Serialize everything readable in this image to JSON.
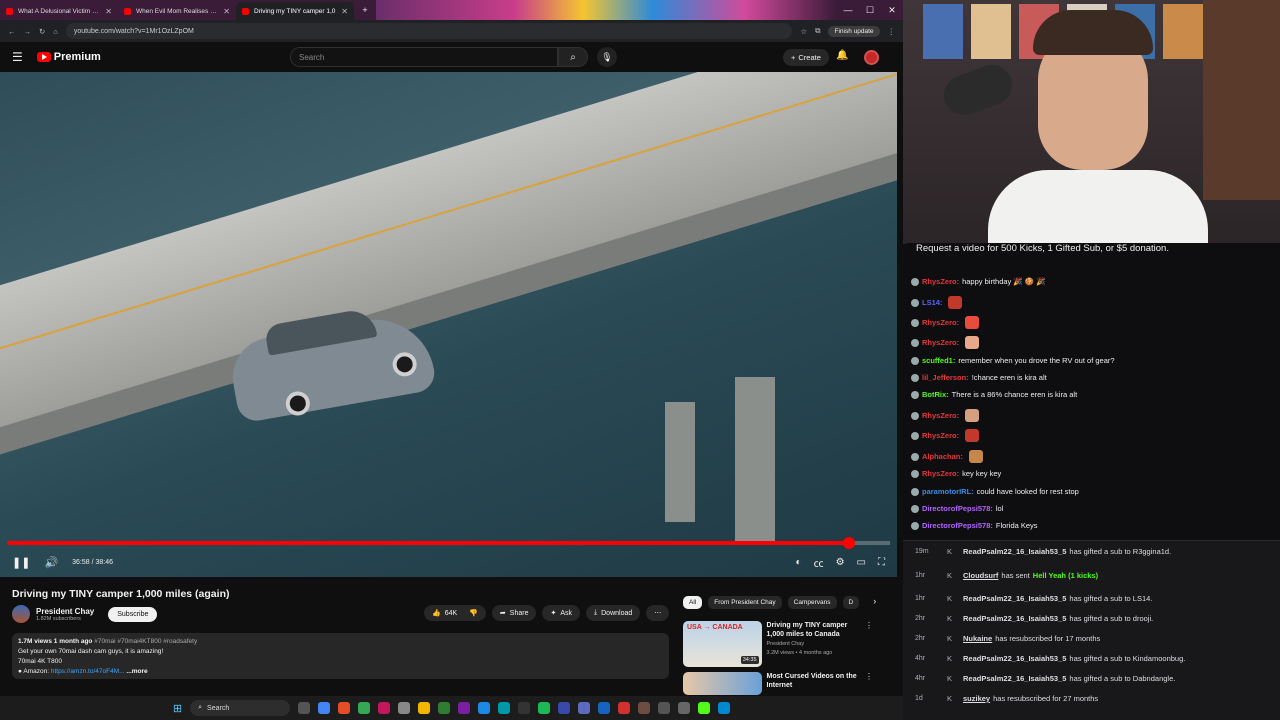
{
  "browser": {
    "tabs": [
      {
        "title": "What A Delusional Victim Com",
        "active": false
      },
      {
        "title": "When Evil Mom Realises She's",
        "active": false
      },
      {
        "title": "Driving my TINY camper 1,0",
        "active": true
      }
    ],
    "url": "youtube.com/watch?v=1Mr1OzLZpOM",
    "update_label": "Finish update"
  },
  "youtube": {
    "logo_text": "Premium",
    "search_placeholder": "Search",
    "create_label": "Create",
    "player": {
      "time": "36:58 / 38:46",
      "progress_fraction": 0.954
    },
    "video": {
      "title": "Driving my TINY camper 1,000 miles (again)",
      "channel": "President Chay",
      "subscribers": "1.82M subscribers",
      "subscribe_label": "Subscribe",
      "likes": "64K",
      "share_label": "Share",
      "ask_label": "Ask",
      "download_label": "Download",
      "description": {
        "meta": "1.7M views  1 month ago",
        "tags": "#70mai #70mai4KT800 #roadsafety",
        "line2": "Get your own 70mai dash cam guys, it is amazing!",
        "line3": "70mai 4K T800",
        "amazon_prefix": "● Amazon: ",
        "amazon_link": "https://amzn.to/47oF4M...",
        "more": "...more"
      }
    },
    "chips": [
      "All",
      "From President Chay",
      "Campervans",
      "D"
    ],
    "recommendations": [
      {
        "title": "Driving my TINY camper 1,000 miles to Canada",
        "channel": "President Chay",
        "meta": "3.2M views • 4 months ago",
        "duration": "34:35",
        "thumb_text": "USA → CANADA"
      },
      {
        "title": "Most Cursed Videos on the Internet",
        "channel": "",
        "meta": "",
        "duration": "",
        "thumb_text": ""
      }
    ]
  },
  "taskbar": {
    "search_label": "Search"
  },
  "stream": {
    "banner": "Request a video for 500 Kicks, 1 Gifted Sub, or $5 donation.",
    "chat": [
      {
        "user": "RhysZero:",
        "color": "#e8363b",
        "text": "happy birthday 🎉 🍪 🎉"
      },
      {
        "user": "LS14:",
        "color": "#5865f2",
        "text": ""
      },
      {
        "user": "RhysZero:",
        "color": "#e8363b",
        "text": ""
      },
      {
        "user": "RhysZero:",
        "color": "#e8363b",
        "text": ""
      },
      {
        "user": "scuffed1:",
        "color": "#53fc18",
        "text": "remember when you drove the RV out of gear?"
      },
      {
        "user": "lil_Jefferson:",
        "color": "#e8363b",
        "text": "!chance eren is kira alt"
      },
      {
        "user": "BotRix:",
        "color": "#53fc18",
        "text": "There is a 86% chance eren is kira alt"
      },
      {
        "user": "RhysZero:",
        "color": "#e8363b",
        "text": ""
      },
      {
        "user": "RhysZero:",
        "color": "#e8363b",
        "text": ""
      },
      {
        "user": "Alphachan:",
        "color": "#e8363b",
        "text": ""
      },
      {
        "user": "RhysZero:",
        "color": "#e8363b",
        "text": "key key key"
      },
      {
        "user": "paramotorIRL:",
        "color": "#3a8ee6",
        "text": "could have looked for rest stop"
      },
      {
        "user": "DirectorofPepsi578:",
        "color": "#b362ff",
        "text": "lol"
      },
      {
        "user": "DirectorofPepsi578:",
        "color": "#b362ff",
        "text": "Florida Keys"
      }
    ],
    "events": [
      {
        "age": "19m",
        "user": "ReadPsalm22_16_Isaiah53_5",
        "text": "has gifted a sub to R3ggina1d."
      },
      {
        "age": "1hr",
        "user": "Cloudsurf",
        "text": "has sent",
        "highlight": "Hell Yeah (1 kicks)"
      },
      {
        "age": "1hr",
        "user": "ReadPsalm22_16_Isaiah53_5",
        "text": "has gifted a sub to LS14."
      },
      {
        "age": "2hr",
        "user": "ReadPsalm22_16_Isaiah53_5",
        "text": "has gifted a sub to drooji."
      },
      {
        "age": "2hr",
        "user": "Nukaine",
        "text": "has resubscribed for 17 months"
      },
      {
        "age": "4hr",
        "user": "ReadPsalm22_16_Isaiah53_5",
        "text": "has gifted a sub to Kindamoonbug."
      },
      {
        "age": "4hr",
        "user": "ReadPsalm22_16_Isaiah53_5",
        "text": "has gifted a sub to Dabndangle."
      },
      {
        "age": "1d",
        "user": "suzikey",
        "text": "has resubscribed for 27 months"
      }
    ]
  }
}
